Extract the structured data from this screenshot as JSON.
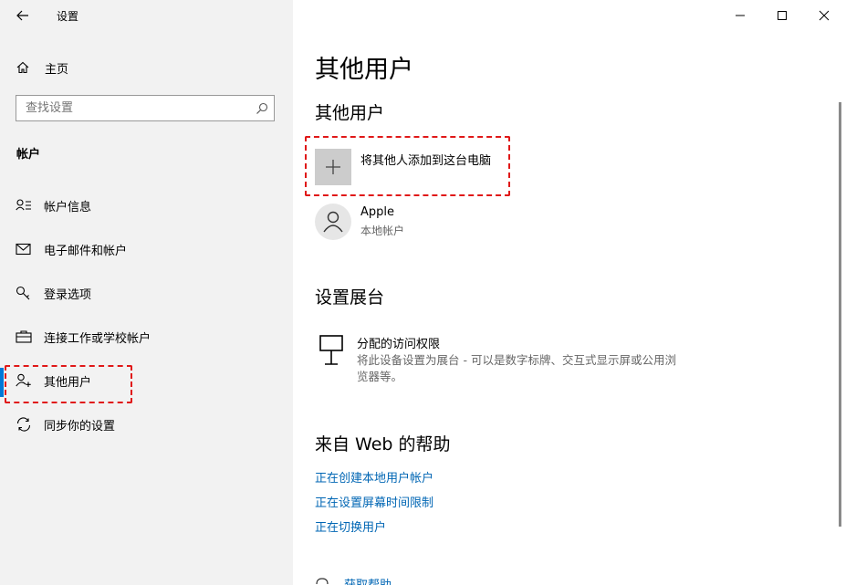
{
  "window": {
    "title": "设置"
  },
  "sidebar": {
    "home_label": "主页",
    "search": {
      "placeholder": "查找设置"
    },
    "section": "帐户",
    "items": [
      {
        "label": "帐户信息",
        "icon": "account-info-icon"
      },
      {
        "label": "电子邮件和帐户",
        "icon": "mail-icon"
      },
      {
        "label": "登录选项",
        "icon": "key-icon"
      },
      {
        "label": "连接工作或学校帐户",
        "icon": "briefcase-icon"
      },
      {
        "label": "其他用户",
        "icon": "add-person-icon",
        "selected": true
      },
      {
        "label": "同步你的设置",
        "icon": "sync-icon"
      }
    ]
  },
  "main": {
    "title": "其他用户",
    "other_users": {
      "heading": "其他用户",
      "add_label": "将其他人添加到这台电脑",
      "user": {
        "name": "Apple",
        "type": "本地帐户"
      }
    },
    "kiosk": {
      "heading": "设置展台",
      "item_title": "分配的访问权限",
      "item_desc_1": "将此设备设置为展台 - 可以是数字标牌、交互式显示屏或公用浏",
      "item_desc_2": "览器等。"
    },
    "help": {
      "heading": "来自 Web 的帮助",
      "links": [
        "正在创建本地用户帐户",
        "正在设置屏幕时间限制",
        "正在切换用户"
      ],
      "get_help": "获取帮助"
    }
  },
  "colors": {
    "accent": "#0078d7",
    "link": "#0066b4",
    "highlight": "#e01818"
  }
}
